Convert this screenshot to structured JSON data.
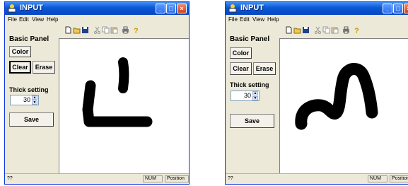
{
  "windows": [
    {
      "title": "INPUT",
      "menu": [
        "File",
        "Edit",
        "View",
        "Help"
      ],
      "panel": {
        "title": "Basic Panel",
        "color_label": "Color",
        "clear_label": "Clear",
        "erase_label": "Erase",
        "thick_label": "Thick setting",
        "thick_value": "30",
        "save_label": "Save"
      },
      "status": {
        "text": "??",
        "num": "NUM",
        "position": "Position"
      }
    },
    {
      "title": "INPUT",
      "menu": [
        "File",
        "Edit",
        "View",
        "Help"
      ],
      "panel": {
        "title": "Basic Panel",
        "color_label": "Color",
        "clear_label": "Clear",
        "erase_label": "Erase",
        "thick_label": "Thick setting",
        "thick_value": "30",
        "save_label": "Save"
      },
      "status": {
        "text": "??",
        "num": "NUM",
        "position": "Position"
      }
    }
  ],
  "toolbar_icons": [
    "new-file-icon",
    "open-folder-icon",
    "save-disk-icon",
    "cut-icon",
    "copy-icon",
    "paste-icon",
    "print-icon",
    "help-icon"
  ],
  "colors": {
    "titlebar": "#0a57d6",
    "ink": "#000000",
    "window_bg": "#ece9d8",
    "close_button": "#d2411c"
  }
}
